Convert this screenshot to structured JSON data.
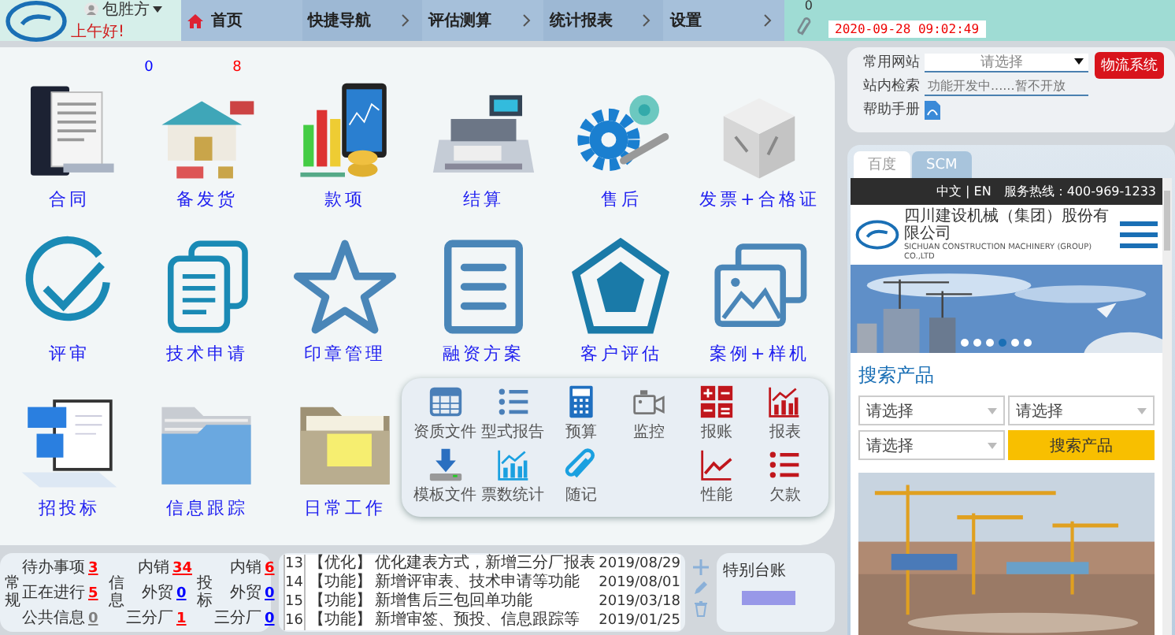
{
  "header": {
    "greeting": "上午好!",
    "user": "包胜方",
    "nav": [
      {
        "label": "首页",
        "kind": "home"
      },
      {
        "label": "快捷导航",
        "kind": "menu"
      },
      {
        "label": "评估测算",
        "kind": "menu"
      },
      {
        "label": "统计报表",
        "kind": "menu"
      },
      {
        "label": "设置",
        "kind": "menu"
      }
    ],
    "attachment_count": "0",
    "datetime": "2020-09-28 09:02:49"
  },
  "tiles": [
    {
      "label": "合同",
      "kind": "contract"
    },
    {
      "label": "备发货",
      "kind": "warehouse",
      "counts": [
        {
          "text": "0",
          "color": "#0000ff"
        },
        {
          "text": "8",
          "color": "#ff0000"
        }
      ]
    },
    {
      "label": "款项",
      "kind": "finance"
    },
    {
      "label": "结算",
      "kind": "register"
    },
    {
      "label": "售后",
      "kind": "gear"
    },
    {
      "label": "发票+合格证",
      "kind": "cube"
    },
    {
      "label": "评审",
      "kind": "check"
    },
    {
      "label": "技术申请",
      "kind": "docs"
    },
    {
      "label": "印章管理",
      "kind": "star"
    },
    {
      "label": "融资方案",
      "kind": "lines"
    },
    {
      "label": "客户评估",
      "kind": "pentagon"
    },
    {
      "label": "案例+样机"
    },
    {
      "label": "招投标",
      "kind": "laptop"
    },
    {
      "label": "信息跟踪",
      "kind": "bluefolder"
    },
    {
      "label": "日常工作",
      "kind": "tanfolder"
    }
  ],
  "quick_panel": {
    "rows": [
      [
        {
          "label": "资质文件",
          "kind": "table"
        },
        {
          "label": "型式报告",
          "kind": "bullets"
        },
        {
          "label": "预算",
          "kind": "calculator"
        },
        {
          "label": "监控",
          "kind": "camera"
        },
        {
          "label": "报账",
          "kind": "arith"
        },
        {
          "label": "报表",
          "kind": "redchart"
        }
      ],
      [
        {
          "label": "模板文件",
          "kind": "download"
        },
        {
          "label": "票数统计",
          "kind": "bluechart"
        },
        {
          "label": "随记",
          "kind": "clip"
        },
        "",
        {
          "label": "性能",
          "kind": "line"
        },
        {
          "label": "欠款",
          "kind": "redbullets"
        }
      ]
    ]
  },
  "summary": [
    {
      "title": "常规",
      "items": [
        {
          "label": "待办事项",
          "count": "3",
          "color": "#ff0000"
        },
        {
          "label": "正在进行",
          "count": "5",
          "color": "#ff0000"
        },
        {
          "label": "公共信息",
          "count": "0",
          "color": "#808080"
        }
      ]
    },
    {
      "title": "信息",
      "items": [
        {
          "label": "内销",
          "count": "34",
          "color": "#ff0000"
        },
        {
          "label": "外贸",
          "count": "0",
          "color": "#0000ff"
        },
        {
          "label": "三分厂",
          "count": "1",
          "color": "#ff0000"
        }
      ]
    },
    {
      "title": "投标",
      "items": [
        {
          "label": "内销",
          "count": "6",
          "color": "#ff0000"
        },
        {
          "label": "外贸",
          "count": "0",
          "color": "#0000ff"
        },
        {
          "label": "三分厂",
          "count": "0",
          "color": "#0000ff"
        }
      ]
    }
  ],
  "updates": [
    {
      "no": "13",
      "tag": "【优化】",
      "text": "优化建表方式，新增三分厂报表",
      "date": "2019/08/29"
    },
    {
      "no": "14",
      "tag": "【功能】",
      "text": "新增评审表、技术申请等功能",
      "date": "2019/08/01"
    },
    {
      "no": "15",
      "tag": "【功能】",
      "text": "新增售后三包回单功能",
      "date": "2019/03/18"
    },
    {
      "no": "16",
      "tag": "【功能】",
      "text": "新增审签、预投、信息跟踪等",
      "date": "2019/01/25"
    }
  ],
  "special": {
    "title": "特别台账"
  },
  "sites": {
    "rows": [
      {
        "label": "常用网站",
        "kind": "select",
        "value": "请选择"
      },
      {
        "label": "站内检索",
        "kind": "search",
        "placeholder": "功能开发中......暂不开放"
      },
      {
        "label": "帮助手册",
        "kind": "pdf"
      }
    ],
    "button": "物流系统"
  },
  "browser": {
    "tabs": [
      {
        "label": "百度",
        "selected": true
      },
      {
        "label": "SCM",
        "selected": false
      }
    ],
    "site": {
      "languages": "中文 | EN",
      "hotline": "服务热线：400-969-1233",
      "company": "四川建设机械（集团）股份有限公司",
      "company_en": "SICHUAN CONSTRUCTION MACHINERY (GROUP) CO.,LTD",
      "carousel": [
        {
          "selected": false
        },
        {
          "selected": false
        },
        {
          "selected": false
        },
        {
          "selected": true
        },
        {
          "selected": false
        },
        {
          "selected": false
        }
      ],
      "search_title": "搜索产品",
      "selects": [
        {
          "placeholder": "请选择"
        },
        {
          "placeholder": "请选择"
        },
        {
          "placeholder": "请选择"
        }
      ],
      "search_button": "搜索产品"
    }
  }
}
